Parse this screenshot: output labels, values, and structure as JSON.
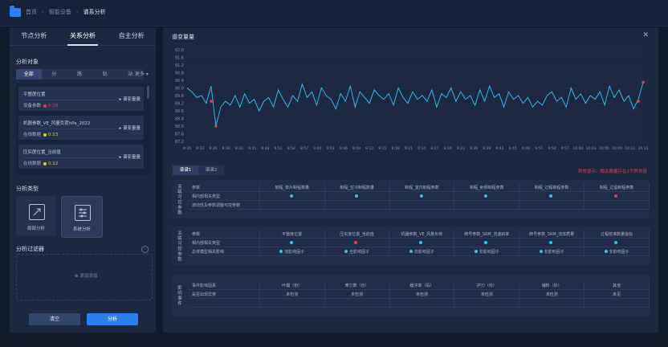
{
  "breadcrumb": [
    "首页",
    "智能设备",
    "谱系分析"
  ],
  "left": {
    "tabs": [
      "节点分析",
      "关系分析",
      "自主分析"
    ],
    "active_tab": 1,
    "object_title": "分析对象",
    "segments": [
      "全部",
      "分",
      "路",
      "轨",
      "站"
    ],
    "more_label": "更多",
    "cards": [
      {
        "title": "平整度位置",
        "status": "设备参数",
        "value": "0.18",
        "dot_color": "#e2404d",
        "action": "谱变量量"
      },
      {
        "title": "机器参数_VE_风量负荷hPa_2022",
        "status": "在线数据",
        "value": "0.13",
        "dot_color": "#e8c93a",
        "action": "谱变量量"
      },
      {
        "title": "压实度位置_当前值",
        "status": "在线数据",
        "value": "0.12",
        "dot_color": "#e8c93a",
        "action": "谱变量量"
      }
    ],
    "type_title": "分析类型",
    "types": [
      "局部分析",
      "系统分析"
    ],
    "filter_title": "分析过滤器",
    "filter_add": "添加添加",
    "clear_label": "清空",
    "analyze_label": "分析"
  },
  "right": {
    "title": "谱变量量",
    "close_icon": "close-icon",
    "tabs": [
      "谱谱1",
      "谱谱2"
    ],
    "warning": "异常提示：相关数据存在2个异常段",
    "group1": {
      "side": "关联可控参数",
      "headers": [
        "参数",
        "制程_单片制程数量",
        "制程_空冷制程数量",
        "制程_室内制程参数",
        "制程_射频制程参数",
        "制程_过程制程参数",
        "制程_过盈制程参数"
      ],
      "row1": {
        "label": "相内部相关类型",
        "dots": [
          "#3ec3e8",
          "#3ec3e8",
          "#3ec3e8",
          "#3ec3e8",
          "#3ec3e8",
          "#e2404d"
        ]
      },
      "row2": {
        "label": "波动性及参数调整可控参数"
      }
    },
    "group2": {
      "side": "关联可控参数",
      "headers": [
        "参数",
        "平整度位置",
        "压实度位置_当前值",
        "机器参数_VE_风量负荷",
        "牌号参数_SRM_流速斜率",
        "牌号参数_SRM_流体质量",
        "过程校准数量指标"
      ],
      "row1": {
        "label": "相内部相关类型",
        "dots": [
          "#3ec3e8",
          "#e2404d",
          "#3ec3e8",
          "#3ec3e8",
          "#3ec3e8",
          "#3ec3e8"
        ]
      },
      "row2": {
        "label": "总体模型相关影响",
        "vals": [
          "非影响因子",
          "全影响因子",
          "非影响因子",
          "非影响因子",
          "非影响因子",
          "非影响因子"
        ]
      }
    },
    "group3": {
      "side": "影响事件",
      "headers": [
        "事件影响因素",
        "叶模（份）",
        "摩力数（份）",
        "缓冲率（码）",
        "护刀（份）",
        "辅料（秒）",
        "其他"
      ],
      "row1": {
        "label": "是否出现异常",
        "vals": [
          "未检测",
          "未检测",
          "未检测",
          "未检测",
          "未检测",
          "未见"
        ]
      }
    }
  },
  "chart_data": {
    "type": "line",
    "y_ticks": [
      "92.0",
      "91.6",
      "91.2",
      "90.8",
      "90.4",
      "90.0",
      "89.6",
      "89.2",
      "88.8",
      "88.4",
      "88.0",
      "87.6",
      "87.2"
    ],
    "ylim": [
      87.2,
      92.0
    ],
    "x_ticks": [
      "8:30",
      "8:33",
      "8:36",
      "8:39",
      "8:42",
      "8:45",
      "8:48",
      "8:51",
      "8:54",
      "8:57",
      "9:00",
      "9:03",
      "9:06",
      "9:09",
      "9:12",
      "9:15",
      "9:18",
      "9:21",
      "9:24",
      "9:27",
      "9:30",
      "9:33",
      "9:36",
      "9:39",
      "9:42",
      "9:45",
      "9:48",
      "9:51",
      "9:54",
      "9:57",
      "10:00",
      "10:03",
      "10:06",
      "10:09",
      "10:12",
      "10:15"
    ],
    "series": [
      {
        "values": [
          90.0,
          89.8,
          89.5,
          89.6,
          89.2,
          90.1,
          88.0,
          89.0,
          89.3,
          89.1,
          89.6,
          89.0,
          89.7,
          89.2,
          89.4,
          88.8,
          89.3,
          89.5,
          89.0,
          89.9,
          89.4,
          89.0,
          89.6,
          89.3,
          90.2,
          89.5,
          89.8,
          89.1,
          90.0,
          89.6,
          89.4,
          88.9,
          89.7,
          89.3,
          90.1,
          89.0,
          89.8,
          89.5,
          89.2,
          89.9,
          89.6,
          89.4,
          89.7,
          89.1,
          90.0,
          89.5,
          89.2,
          89.8,
          89.4,
          89.6,
          89.3,
          89.9,
          89.0,
          89.7,
          89.5,
          90.0,
          89.3,
          89.8,
          89.4,
          89.6,
          89.1,
          89.9,
          89.3,
          90.1,
          89.5,
          89.7,
          89.0,
          89.8,
          89.4,
          89.6,
          89.2,
          89.5,
          89.0,
          89.3,
          89.1,
          89.6,
          89.8,
          89.3,
          89.5,
          89.0,
          90.0,
          89.4,
          89.7,
          89.2,
          89.6,
          89.4,
          89.8,
          89.1,
          90.1,
          89.5,
          89.9,
          89.3,
          89.6,
          88.9,
          89.4,
          90.3
        ]
      }
    ],
    "anomalies": [
      [
        5,
        89.3
      ],
      [
        6,
        88.0
      ],
      [
        94,
        89.3
      ],
      [
        95,
        90.3
      ]
    ]
  }
}
